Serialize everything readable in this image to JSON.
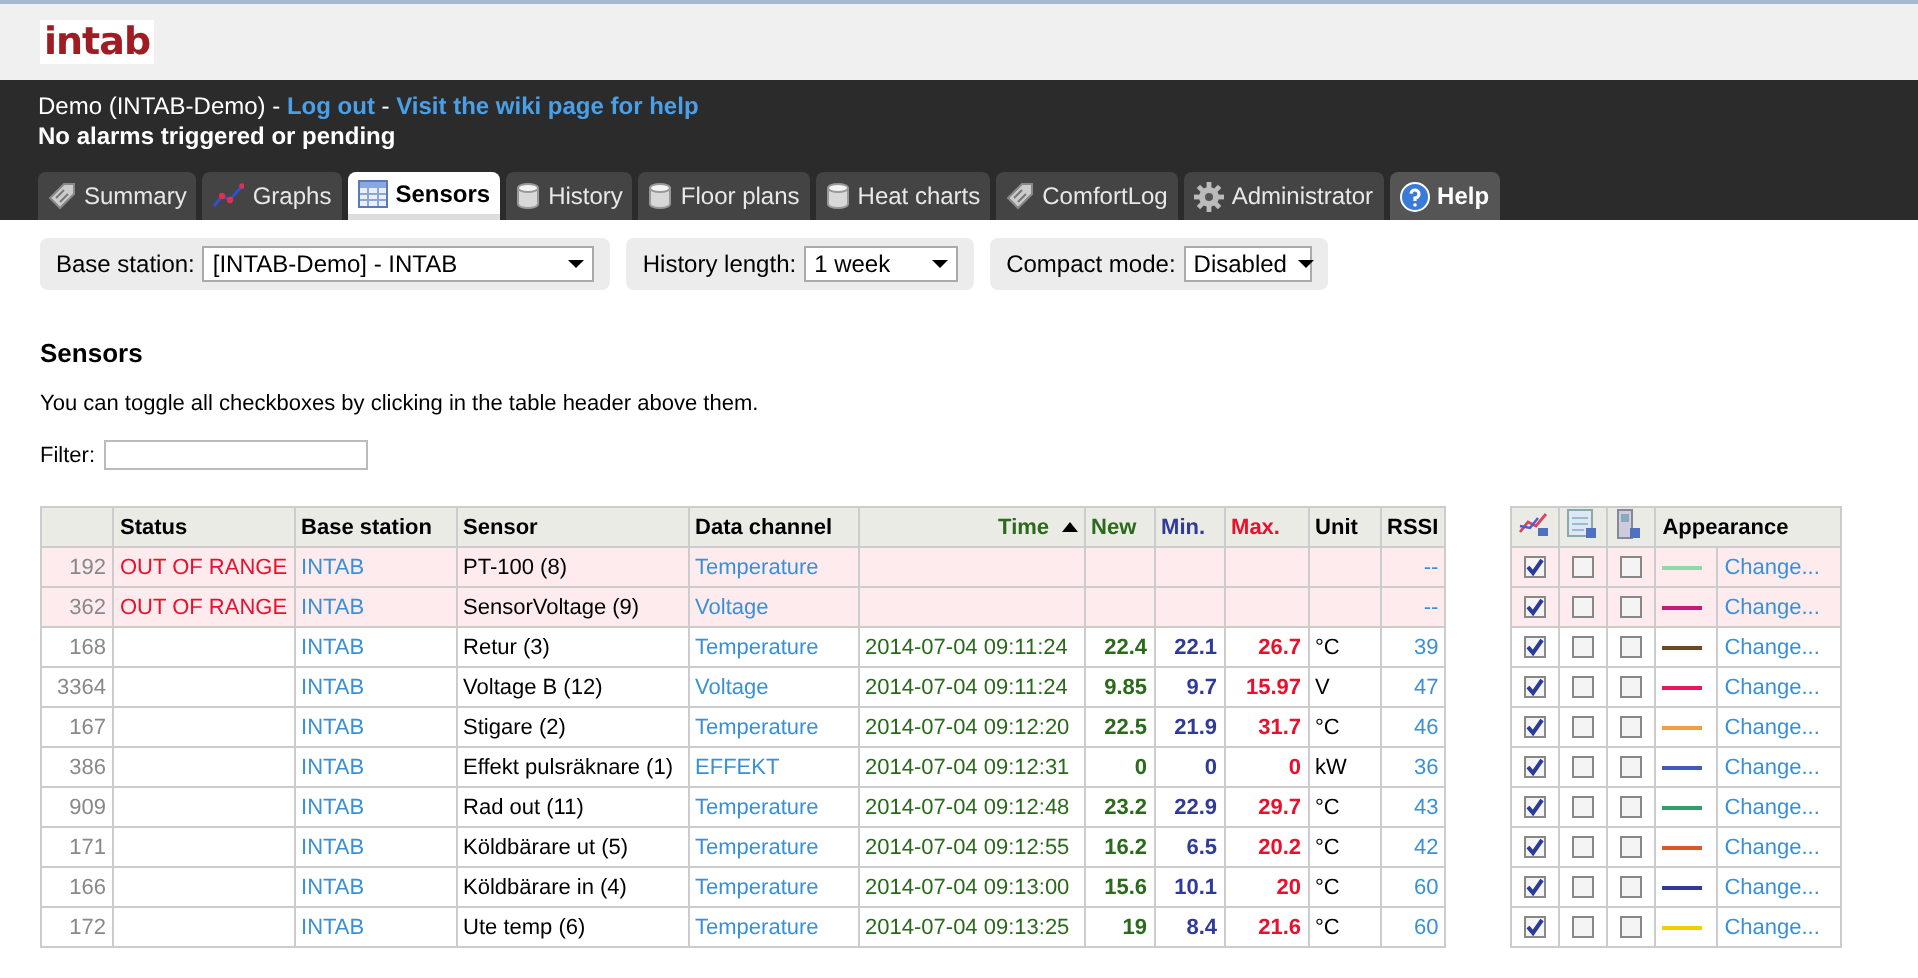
{
  "logo": "intab",
  "account": {
    "user": "Demo (INTAB-Demo)",
    "separator_1": " - ",
    "logout": "Log out",
    "separator_2": " - ",
    "wiki": "Visit the wiki page for help"
  },
  "alarm_status": "No alarms triggered or pending",
  "tabs": [
    {
      "label": "Summary",
      "kind": "tag",
      "selected": false
    },
    {
      "label": "Graphs",
      "kind": "graph",
      "selected": false
    },
    {
      "label": "Sensors",
      "kind": "table",
      "selected": true
    },
    {
      "label": "History",
      "kind": "cylinder",
      "selected": false
    },
    {
      "label": "Floor plans",
      "kind": "cylinder",
      "selected": false
    },
    {
      "label": "Heat charts",
      "kind": "cylinder",
      "selected": false
    },
    {
      "label": "ComfortLog",
      "kind": "tag",
      "selected": false
    },
    {
      "label": "Administrator",
      "kind": "gear",
      "selected": false
    },
    {
      "label": "Help",
      "kind": "help",
      "selected": false
    }
  ],
  "filters": [
    {
      "label": "Base station:",
      "value": "[INTAB-Demo] - INTAB"
    },
    {
      "label": "History length:",
      "value": "1 week"
    },
    {
      "label": "Compact mode:",
      "value": "Disabled"
    }
  ],
  "heading": "Sensors",
  "hint": "You can toggle all checkboxes by clicking in the table header above them.",
  "filter": {
    "label": "Filter:"
  },
  "table": {
    "columns": [
      "Status",
      "Base station",
      "Sensor",
      "Data channel",
      "Time",
      "New",
      "Min.",
      "Max.",
      "Unit",
      "RSSI"
    ],
    "rows": [
      {
        "index": "192",
        "out_of_range": true,
        "status": "OUT OF RANGE",
        "base_station": "INTAB",
        "sensor": "PT-100 (8)",
        "data_channel": "Temperature",
        "rssi": "--"
      },
      {
        "index": "362",
        "out_of_range": true,
        "status": "OUT OF RANGE",
        "base_station": "INTAB",
        "sensor": "SensorVoltage (9)",
        "data_channel": "Voltage",
        "rssi": "--"
      },
      {
        "index": "168",
        "out_of_range": false,
        "base_station": "INTAB",
        "sensor": "Retur (3)",
        "data_channel": "Temperature",
        "time": "2014-07-04 09:11:24",
        "new": "22.4",
        "min": "22.1",
        "max": "26.7",
        "unit": "°C",
        "rssi": "39"
      },
      {
        "index": "3364",
        "out_of_range": false,
        "base_station": "INTAB",
        "sensor": "Voltage B (12)",
        "data_channel": "Voltage",
        "time": "2014-07-04 09:11:24",
        "new": "9.85",
        "min": "9.7",
        "max": "15.97",
        "unit": "V",
        "rssi": "47"
      },
      {
        "index": "167",
        "out_of_range": false,
        "base_station": "INTAB",
        "sensor": "Stigare (2)",
        "data_channel": "Temperature",
        "time": "2014-07-04 09:12:20",
        "new": "22.5",
        "min": "21.9",
        "max": "31.7",
        "unit": "°C",
        "rssi": "46"
      },
      {
        "index": "386",
        "out_of_range": false,
        "base_station": "INTAB",
        "sensor": "Effekt pulsräknare (1)",
        "data_channel": "EFFEKT",
        "time": "2014-07-04 09:12:31",
        "new": "0",
        "min": "0",
        "max": "0",
        "unit": "kW",
        "rssi": "36"
      },
      {
        "index": "909",
        "out_of_range": false,
        "base_station": "INTAB",
        "sensor": "Rad out (11)",
        "data_channel": "Temperature",
        "time": "2014-07-04 09:12:48",
        "new": "23.2",
        "min": "22.9",
        "max": "29.7",
        "unit": "°C",
        "rssi": "43"
      },
      {
        "index": "171",
        "out_of_range": false,
        "base_station": "INTAB",
        "sensor": "Köldbärare ut (5)",
        "data_channel": "Temperature",
        "time": "2014-07-04 09:12:55",
        "new": "16.2",
        "min": "6.5",
        "max": "20.2",
        "unit": "°C",
        "rssi": "42"
      },
      {
        "index": "166",
        "out_of_range": false,
        "base_station": "INTAB",
        "sensor": "Köldbärare in (4)",
        "data_channel": "Temperature",
        "time": "2014-07-04 09:13:00",
        "new": "15.6",
        "min": "10.1",
        "max": "20",
        "unit": "°C",
        "rssi": "60"
      },
      {
        "index": "172",
        "out_of_range": false,
        "base_station": "INTAB",
        "sensor": "Ute temp (6)",
        "data_channel": "Temperature",
        "time": "2014-07-04 09:13:25",
        "new": "19",
        "min": "8.4",
        "max": "21.6",
        "unit": "°C",
        "rssi": "60"
      }
    ]
  },
  "appearance": {
    "column": "Appearance",
    "rows": [
      {
        "graph": true,
        "option_2": false,
        "option_3": false,
        "out_of_range": true,
        "color": "#90d8a8",
        "link": "Change..."
      },
      {
        "graph": true,
        "option_2": false,
        "option_3": false,
        "out_of_range": true,
        "color": "#c8187c",
        "link": "Change..."
      },
      {
        "graph": true,
        "option_2": false,
        "option_3": false,
        "out_of_range": false,
        "color": "#6c4a20",
        "link": "Change..."
      },
      {
        "graph": true,
        "option_2": false,
        "option_3": false,
        "out_of_range": false,
        "color": "#e8185c",
        "link": "Change..."
      },
      {
        "graph": true,
        "option_2": false,
        "option_3": false,
        "out_of_range": false,
        "color": "#f0a040",
        "link": "Change..."
      },
      {
        "graph": true,
        "option_2": false,
        "option_3": false,
        "out_of_range": false,
        "color": "#4058b8",
        "link": "Change..."
      },
      {
        "graph": true,
        "option_2": false,
        "option_3": false,
        "out_of_range": false,
        "color": "#30a068",
        "link": "Change..."
      },
      {
        "graph": true,
        "option_2": false,
        "option_3": false,
        "out_of_range": false,
        "color": "#d85828",
        "link": "Change..."
      },
      {
        "graph": true,
        "option_2": false,
        "option_3": false,
        "out_of_range": false,
        "color": "#303898",
        "link": "Change..."
      },
      {
        "graph": true,
        "option_2": false,
        "option_3": false,
        "out_of_range": false,
        "color": "#f0d000",
        "link": "Change..."
      }
    ]
  }
}
